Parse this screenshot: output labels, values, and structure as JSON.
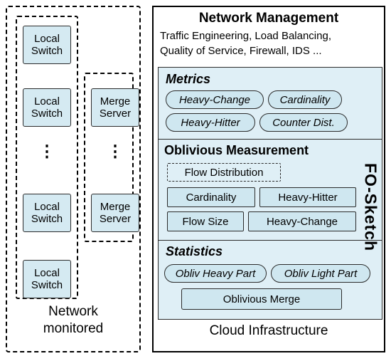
{
  "left": {
    "caption_line1": "Network",
    "caption_line2": "monitored",
    "switches": [
      {
        "line1": "Local",
        "line2": "Switch"
      },
      {
        "line1": "Local",
        "line2": "Switch"
      },
      {
        "line1": "Local",
        "line2": "Switch"
      },
      {
        "line1": "Local",
        "line2": "Switch"
      }
    ],
    "merge_servers": [
      {
        "line1": "Merge",
        "line2": "Server"
      },
      {
        "line1": "Merge",
        "line2": "Server"
      }
    ],
    "ellipsis": "⋮"
  },
  "right": {
    "header": {
      "title": "Network Management",
      "subtitle_line1": "Traffic Engineering, Load Balancing,",
      "subtitle_line2": "Quality of Service, Firewall, IDS ..."
    },
    "fo_sketch_label": "FO-Sketch",
    "sections": [
      {
        "title": "Metrics",
        "items": [
          "Heavy-Change",
          "Cardinality",
          "Heavy-Hitter",
          "Counter Dist."
        ]
      },
      {
        "title": "Oblivious Measurement",
        "items": [
          "Flow Distribution",
          "Cardinality",
          "Heavy-Hitter",
          "Flow Size",
          "Heavy-Change"
        ]
      },
      {
        "title": "Statistics",
        "items": [
          "Obliv Heavy Part",
          "Obliv Light Part",
          "Oblivious Merge"
        ]
      }
    ],
    "footer": "Cloud Infrastructure"
  },
  "colors": {
    "box_fill": "#d5eaf2",
    "panel_fill": "#dfeff6",
    "pill_fill": "#cfe7f0",
    "stroke": "#2b2b2b",
    "text": "#000000"
  }
}
